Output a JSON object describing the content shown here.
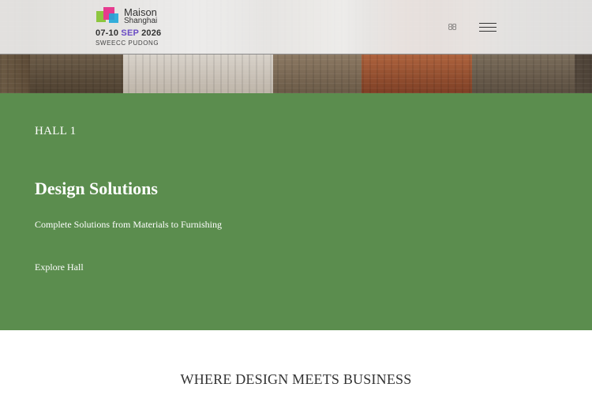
{
  "header": {
    "logo": {
      "name": "Maison",
      "city": "Shanghai",
      "dates_prefix": "07-10",
      "dates_month": "SEP",
      "dates_year": "2026",
      "venue": "SWEECC  PUDONG"
    },
    "search_icon": "search-icon",
    "menu_icon": "hamburger-menu-icon"
  },
  "hall": {
    "label": "HALL 1",
    "title": "Design Solutions",
    "description": "Complete Solutions from Materials to Furnishing",
    "link_label": "Explore Hall",
    "link_icon_glyph": ""
  },
  "tagline": "WHERE DESIGN MEETS BUSINESS",
  "colors": {
    "panel_green": "#5b8d4e",
    "logo_green": "#8dc63f",
    "logo_pink": "#e63b8f",
    "logo_blue": "#1fa7d9",
    "logo_purple": "#6a4bc4"
  }
}
